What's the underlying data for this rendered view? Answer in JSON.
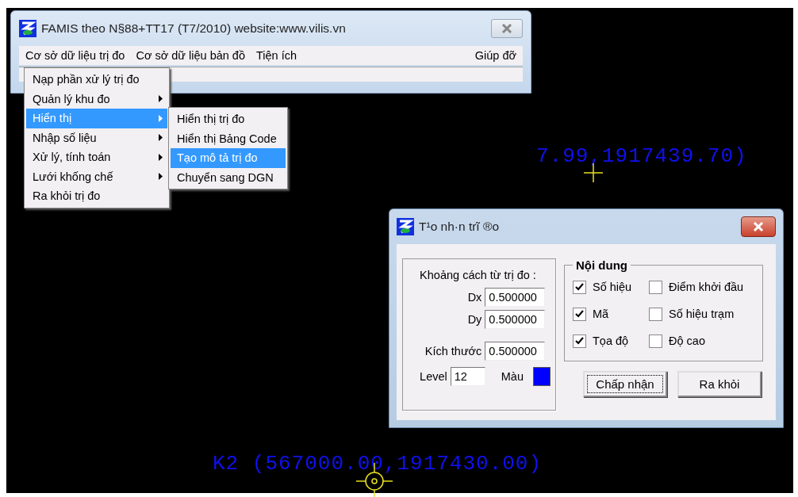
{
  "main_window": {
    "title": "FAMIS theo N§88+TT17 (T7/2010)  website:www.vilis.vn"
  },
  "menu_bar": [
    {
      "label": "Cơ sở dữ liệu trị đo"
    },
    {
      "label": "Cơ sở dữ liệu bản đồ"
    },
    {
      "label": "Tiện ích"
    },
    {
      "label": "Giúp đỡ"
    }
  ],
  "menu": [
    {
      "label": "Nạp phần xử lý trị đo",
      "has_submenu": false,
      "selected": false
    },
    {
      "label": "Quản lý khu đo",
      "has_submenu": true,
      "selected": false
    },
    {
      "label": "Hiển thị",
      "has_submenu": true,
      "selected": true
    },
    {
      "label": "Nhập số liệu",
      "has_submenu": true,
      "selected": false
    },
    {
      "label": "Xử lý, tính toán",
      "has_submenu": true,
      "selected": false
    },
    {
      "label": "Lưới khống chế",
      "has_submenu": true,
      "selected": false
    },
    {
      "label": "Ra khỏi trị đo",
      "has_submenu": false,
      "selected": false
    }
  ],
  "submenu": [
    {
      "label": "Hiển thị trị đo",
      "selected": false
    },
    {
      "label": "Hiển thị Bảng Code",
      "selected": false
    },
    {
      "label": "Tạo mô tả trị đo",
      "selected": true
    },
    {
      "label": "Chuyển sang DGN",
      "selected": false
    }
  ],
  "canvas_labels": [
    {
      "text": "7.99,1917439.70)"
    },
    {
      "text": "K2 (567000.00,1917430.00)"
    }
  ],
  "dialog": {
    "title": "T¹o nh·n trĩ ®o",
    "distance_group": {
      "label": "Khoảng cách từ trị đo :",
      "dx": {
        "label": "Dx",
        "value": "0.500000"
      },
      "dy": {
        "label": "Dy",
        "value": "0.500000"
      }
    },
    "size": {
      "label": "Kích thước",
      "value": "0.500000"
    },
    "level": {
      "label": "Level",
      "value": "12"
    },
    "color": {
      "label": "Màu",
      "color": "#0000ff"
    },
    "content_group": {
      "title": "Nội dung",
      "options": [
        {
          "label": "Số hiệu",
          "checked": true
        },
        {
          "label": "Mã",
          "checked": true
        },
        {
          "label": "Tọa độ",
          "checked": true
        },
        {
          "label": "Điểm khởi đầu",
          "checked": false
        },
        {
          "label": "Số hiệu trạm",
          "checked": false
        },
        {
          "label": "Độ cao",
          "checked": false
        }
      ]
    },
    "buttons": [
      {
        "label": "Chấp nhận",
        "focused": true
      },
      {
        "label": "Ra khỏi",
        "focused": false
      }
    ]
  }
}
